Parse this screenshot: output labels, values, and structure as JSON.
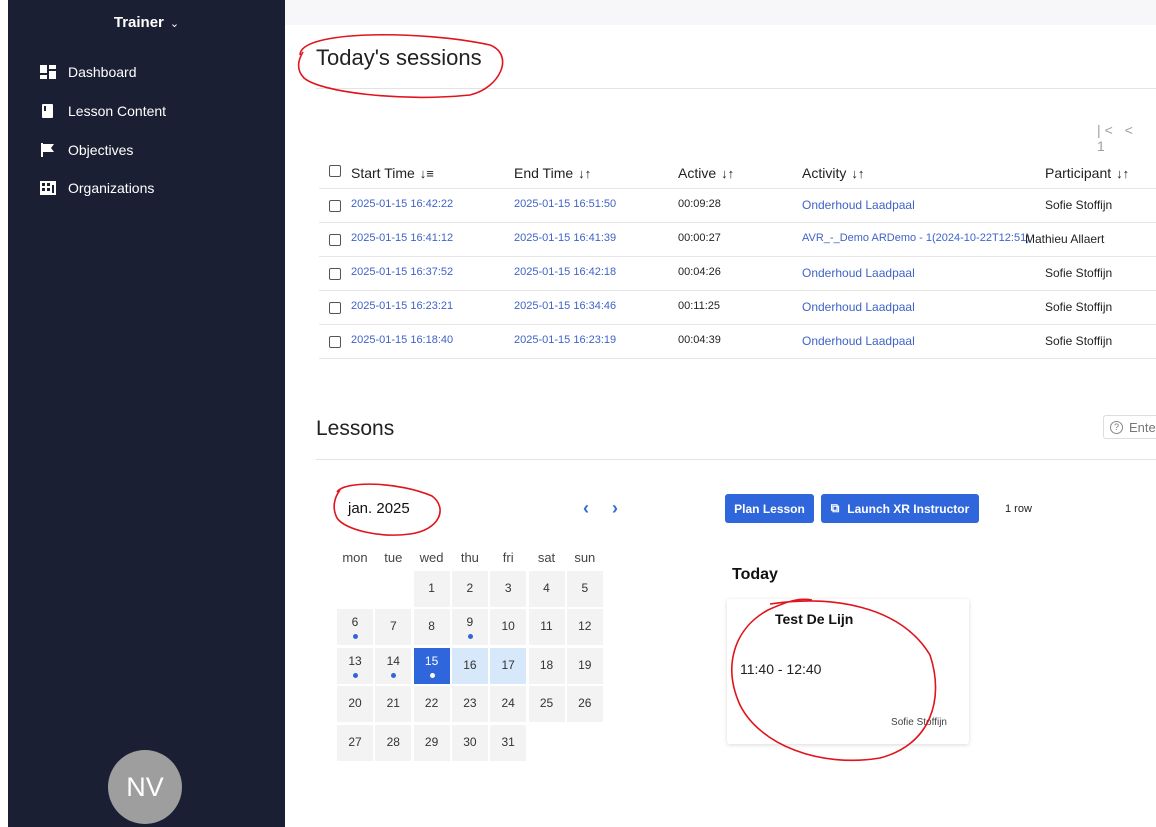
{
  "sidebar": {
    "title": "Trainer",
    "items": [
      {
        "label": "Dashboard"
      },
      {
        "label": "Lesson Content"
      },
      {
        "label": "Objectives"
      },
      {
        "label": "Organizations"
      }
    ],
    "avatar_initials": "NV"
  },
  "sessions": {
    "title": "Today's sessions",
    "pager_text": "|< < 1",
    "columns": [
      "Start Time",
      "End Time",
      "Active",
      "Activity",
      "Participant"
    ],
    "rows": [
      {
        "start": "2025-01-15 16:42:22",
        "end": "2025-01-15 16:51:50",
        "active": "00:09:28",
        "activity": "Onderhoud Laadpaal",
        "participant": "Sofie Stoffijn"
      },
      {
        "start": "2025-01-15 16:41:12",
        "end": "2025-01-15 16:41:39",
        "active": "00:00:27",
        "activity": "AVR_-_Demo ARDemo - 1(2024-10-22T12:51)",
        "participant": "Mathieu Allaert"
      },
      {
        "start": "2025-01-15 16:37:52",
        "end": "2025-01-15 16:42:18",
        "active": "00:04:26",
        "activity": "Onderhoud Laadpaal",
        "participant": "Sofie Stoffijn"
      },
      {
        "start": "2025-01-15 16:23:21",
        "end": "2025-01-15 16:34:46",
        "active": "00:11:25",
        "activity": "Onderhoud Laadpaal",
        "participant": "Sofie Stoffijn"
      },
      {
        "start": "2025-01-15 16:18:40",
        "end": "2025-01-15 16:23:19",
        "active": "00:04:39",
        "activity": "Onderhoud Laadpaal",
        "participant": "Sofie Stoffijn"
      }
    ]
  },
  "lessons": {
    "title": "Lessons",
    "help_text": "Ente",
    "calendar": {
      "month_label": "jan. 2025",
      "prev": "‹",
      "next": "›",
      "weekdays": [
        "mon",
        "tue",
        "wed",
        "thu",
        "fri",
        "sat",
        "sun"
      ],
      "first_weekday_index": 2,
      "days_in_month": 31,
      "selected_day": 15,
      "highlighted_days": [
        16,
        17
      ],
      "days_with_dot": [
        6,
        9,
        13,
        14,
        15
      ]
    },
    "plan_lesson_label": "Plan Lesson",
    "launch_label": "Launch XR Instructor",
    "row_count": "1 row",
    "today_title": "Today",
    "card": {
      "title": "Test De Lijn",
      "time": "11:40 - 12:40",
      "participant": "Sofie Stoffijn"
    }
  },
  "colors": {
    "sidebar_bg": "#1b1f33",
    "accent": "#2f66dc",
    "link": "#3f63c8",
    "annotation_red": "#e0141c"
  }
}
